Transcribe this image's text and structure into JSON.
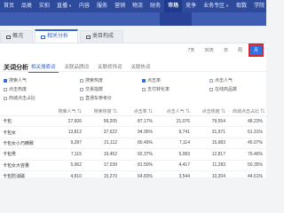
{
  "topnav": [
    {
      "label": "首页",
      "caret": false,
      "active": false
    },
    {
      "label": "品类",
      "caret": false,
      "active": false
    },
    {
      "label": "实拍",
      "caret": false,
      "active": false
    },
    {
      "label": "直播",
      "caret": true,
      "active": false
    },
    {
      "label": "内容",
      "caret": false,
      "active": false
    },
    {
      "label": "服务",
      "caret": false,
      "active": false
    },
    {
      "label": "营销",
      "caret": false,
      "active": false
    },
    {
      "label": "物流",
      "caret": false,
      "active": false
    },
    {
      "label": "财务",
      "caret": false,
      "active": false
    },
    {
      "label": "市场",
      "caret": false,
      "active": true
    },
    {
      "label": "竞争",
      "caret": false,
      "active": false
    },
    {
      "label": "业务专区",
      "caret": true,
      "active": false
    },
    {
      "label": "取数",
      "caret": false,
      "active": false
    },
    {
      "label": "学院",
      "caret": false,
      "active": false
    }
  ],
  "subnav": [
    "",
    "",
    "",
    "",
    "",
    "",
    "",
    ""
  ],
  "subnav_active": 5,
  "tabs": [
    {
      "label": "概况",
      "active": false
    },
    {
      "label": "相关分析",
      "active": true
    },
    {
      "label": "类目构成",
      "active": false
    }
  ],
  "toolbar": {
    "b1": "7天",
    "b2": "30天",
    "b3": "日",
    "b4": "周",
    "b5": "月"
  },
  "section_title": "关词分析",
  "subtabs": [
    {
      "label": "相关搜索词",
      "active": true
    },
    {
      "label": "关联品牌词",
      "active": false
    },
    {
      "label": "关联修饰词",
      "active": false
    },
    {
      "label": "关联热词",
      "active": false
    }
  ],
  "options": [
    [
      {
        "label": "搜索人气",
        "checked": true
      },
      {
        "label": "搜索热度",
        "checked": false
      },
      {
        "label": "点击率",
        "checked": true
      },
      {
        "label": "点击人气",
        "checked": false
      }
    ],
    [
      {
        "label": "点击热度",
        "checked": false
      },
      {
        "label": "交易指数",
        "checked": false
      },
      {
        "label": "支付转化率",
        "checked": false
      },
      {
        "label": "在线商品数",
        "checked": false
      }
    ],
    [
      {
        "label": "商城点击占比",
        "checked": false
      },
      {
        "label": "直通车参考价",
        "checked": false
      },
      {
        "label": "",
        "checked": false
      },
      {
        "label": "",
        "checked": false
      }
    ]
  ],
  "table": {
    "headers": [
      "",
      "搜索人气 ⇅",
      "搜索热度 ⇅",
      "点击率 ⇅",
      "点击人气 ⇅",
      "点击热度 ⇅",
      "商城点击占比 ⇅"
    ],
    "rows": [
      [
        "卡包",
        "27,606",
        "99,205",
        "87.17%",
        "21,076",
        "79,554",
        "48.23%"
      ],
      [
        "卡包女",
        "13,812",
        "37,622",
        "94.95%",
        "9,741",
        "31,971",
        "61.31%"
      ],
      [
        "卡包女小巧精致",
        "9,287",
        "21,112",
        "80.49%",
        "7,114",
        "15,983",
        "45.07%"
      ],
      [
        "卡包男",
        "7,115",
        "19,452",
        "92.37%",
        "5,083",
        "12,817",
        "70.46%"
      ],
      [
        "卡包女大容量",
        "5,962",
        "17,039",
        "81.50%",
        "4,417",
        "11,283",
        "50.35%"
      ],
      [
        "卡包防消磁",
        "4,810",
        "15,270",
        "64.83%",
        "3,544",
        "10,204",
        "44.61%"
      ]
    ]
  }
}
